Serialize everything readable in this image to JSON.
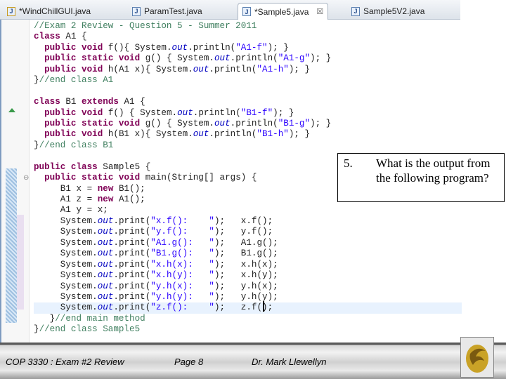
{
  "tabs": [
    {
      "label": "*WindChillGUI.java",
      "icon": "java-file-warning-icon"
    },
    {
      "label": "ParamTest.java",
      "icon": "java-file-icon"
    },
    {
      "label": "*Sample5.java",
      "icon": "java-file-icon",
      "active": true
    },
    {
      "label": "Sample5V2.java",
      "icon": "java-file-icon"
    }
  ],
  "close_glyph": "☒",
  "code_lines": [
    [
      [
        "c",
        "//Exam 2 Review - Question 5 - Summer 2011"
      ]
    ],
    [
      [
        "k",
        "class"
      ],
      [
        "p",
        " A1 {"
      ]
    ],
    [
      [
        "p",
        "  "
      ],
      [
        "k",
        "public void"
      ],
      [
        "p",
        " f(){ System."
      ],
      [
        "i",
        "out"
      ],
      [
        "p",
        ".println("
      ],
      [
        "s",
        "\"A1-f\""
      ],
      [
        "p",
        "); }"
      ]
    ],
    [
      [
        "p",
        "  "
      ],
      [
        "k",
        "public static void"
      ],
      [
        "p",
        " g() { System."
      ],
      [
        "i",
        "out"
      ],
      [
        "p",
        ".println("
      ],
      [
        "s",
        "\"A1-g\""
      ],
      [
        "p",
        "); }"
      ]
    ],
    [
      [
        "p",
        "  "
      ],
      [
        "k",
        "public void"
      ],
      [
        "p",
        " h(A1 x){ System."
      ],
      [
        "i",
        "out"
      ],
      [
        "p",
        ".println("
      ],
      [
        "s",
        "\"A1-h\""
      ],
      [
        "p",
        "); }"
      ]
    ],
    [
      [
        "p",
        "}"
      ],
      [
        "c",
        "//end class A1"
      ]
    ],
    [
      [
        "p",
        ""
      ]
    ],
    [
      [
        "k",
        "class"
      ],
      [
        "p",
        " B1 "
      ],
      [
        "k",
        "extends"
      ],
      [
        "p",
        " A1 {"
      ]
    ],
    [
      [
        "p",
        "  "
      ],
      [
        "k",
        "public void"
      ],
      [
        "p",
        " f() { System."
      ],
      [
        "i",
        "out"
      ],
      [
        "p",
        ".println("
      ],
      [
        "s",
        "\"B1-f\""
      ],
      [
        "p",
        "); }"
      ]
    ],
    [
      [
        "p",
        "  "
      ],
      [
        "k",
        "public static void"
      ],
      [
        "p",
        " g() { System."
      ],
      [
        "i",
        "out"
      ],
      [
        "p",
        ".println("
      ],
      [
        "s",
        "\"B1-g\""
      ],
      [
        "p",
        "); }"
      ]
    ],
    [
      [
        "p",
        "  "
      ],
      [
        "k",
        "public void"
      ],
      [
        "p",
        " h(B1 x){ System."
      ],
      [
        "i",
        "out"
      ],
      [
        "p",
        ".println("
      ],
      [
        "s",
        "\"B1-h\""
      ],
      [
        "p",
        "); }"
      ]
    ],
    [
      [
        "p",
        "}"
      ],
      [
        "c",
        "//end class B1"
      ]
    ],
    [
      [
        "p",
        ""
      ]
    ],
    [
      [
        "k",
        "public class"
      ],
      [
        "p",
        " Sample5 {"
      ]
    ],
    [
      [
        "p",
        "  "
      ],
      [
        "k",
        "public static void"
      ],
      [
        "p",
        " main(String[] args) {"
      ]
    ],
    [
      [
        "p",
        "     B1 x = "
      ],
      [
        "k",
        "new"
      ],
      [
        "p",
        " B1();"
      ]
    ],
    [
      [
        "p",
        "     A1 z = "
      ],
      [
        "k",
        "new"
      ],
      [
        "p",
        " A1();"
      ]
    ],
    [
      [
        "p",
        "     A1 y = x;"
      ]
    ],
    [
      [
        "p",
        "     System."
      ],
      [
        "i",
        "out"
      ],
      [
        "p",
        ".print("
      ],
      [
        "s",
        "\"x.f():    \""
      ],
      [
        "p",
        ");   x.f();"
      ]
    ],
    [
      [
        "p",
        "     System."
      ],
      [
        "i",
        "out"
      ],
      [
        "p",
        ".print("
      ],
      [
        "s",
        "\"y.f():    \""
      ],
      [
        "p",
        ");   y.f();"
      ]
    ],
    [
      [
        "p",
        "     System."
      ],
      [
        "i",
        "out"
      ],
      [
        "p",
        ".print("
      ],
      [
        "s",
        "\"A1.g():   \""
      ],
      [
        "p",
        ");   A1.g();"
      ]
    ],
    [
      [
        "p",
        "     System."
      ],
      [
        "i",
        "out"
      ],
      [
        "p",
        ".print("
      ],
      [
        "s",
        "\"B1.g():   \""
      ],
      [
        "p",
        ");   B1.g();"
      ]
    ],
    [
      [
        "p",
        "     System."
      ],
      [
        "i",
        "out"
      ],
      [
        "p",
        ".print("
      ],
      [
        "s",
        "\"x.h(x):   \""
      ],
      [
        "p",
        ");   x.h(x);"
      ]
    ],
    [
      [
        "p",
        "     System."
      ],
      [
        "i",
        "out"
      ],
      [
        "p",
        ".print("
      ],
      [
        "s",
        "\"x.h(y):   \""
      ],
      [
        "p",
        ");   x.h(y);"
      ]
    ],
    [
      [
        "p",
        "     System."
      ],
      [
        "i",
        "out"
      ],
      [
        "p",
        ".print("
      ],
      [
        "s",
        "\"y.h(x):   \""
      ],
      [
        "p",
        ");   y.h(x);"
      ]
    ],
    [
      [
        "p",
        "     System."
      ],
      [
        "i",
        "out"
      ],
      [
        "p",
        ".print("
      ],
      [
        "s",
        "\"y.h(y):   \""
      ],
      [
        "p",
        ");   y.h(y);"
      ]
    ],
    [
      [
        "p",
        "     System."
      ],
      [
        "i",
        "out"
      ],
      [
        "p",
        ".print("
      ],
      [
        "s",
        "\"z.f():    \""
      ],
      [
        "p",
        ");   z.f();"
      ]
    ],
    [
      [
        "p",
        "   }"
      ],
      [
        "c",
        "//end main method"
      ]
    ],
    [
      [
        "p",
        "}"
      ],
      [
        "c",
        "//end class Sample5"
      ]
    ]
  ],
  "current_line": 26,
  "question": {
    "number": "5.",
    "text": "What is the output from the following program?"
  },
  "footer": {
    "course": "COP 3330 : Exam #2 Review",
    "page": "Page 8",
    "author": "Dr. Mark Llewellyn"
  },
  "colors": {
    "keyword": "#7f0055",
    "comment": "#3f7f5f",
    "string": "#2a00ff",
    "field": "#0000c0",
    "current_line": "#e8f2fe"
  }
}
